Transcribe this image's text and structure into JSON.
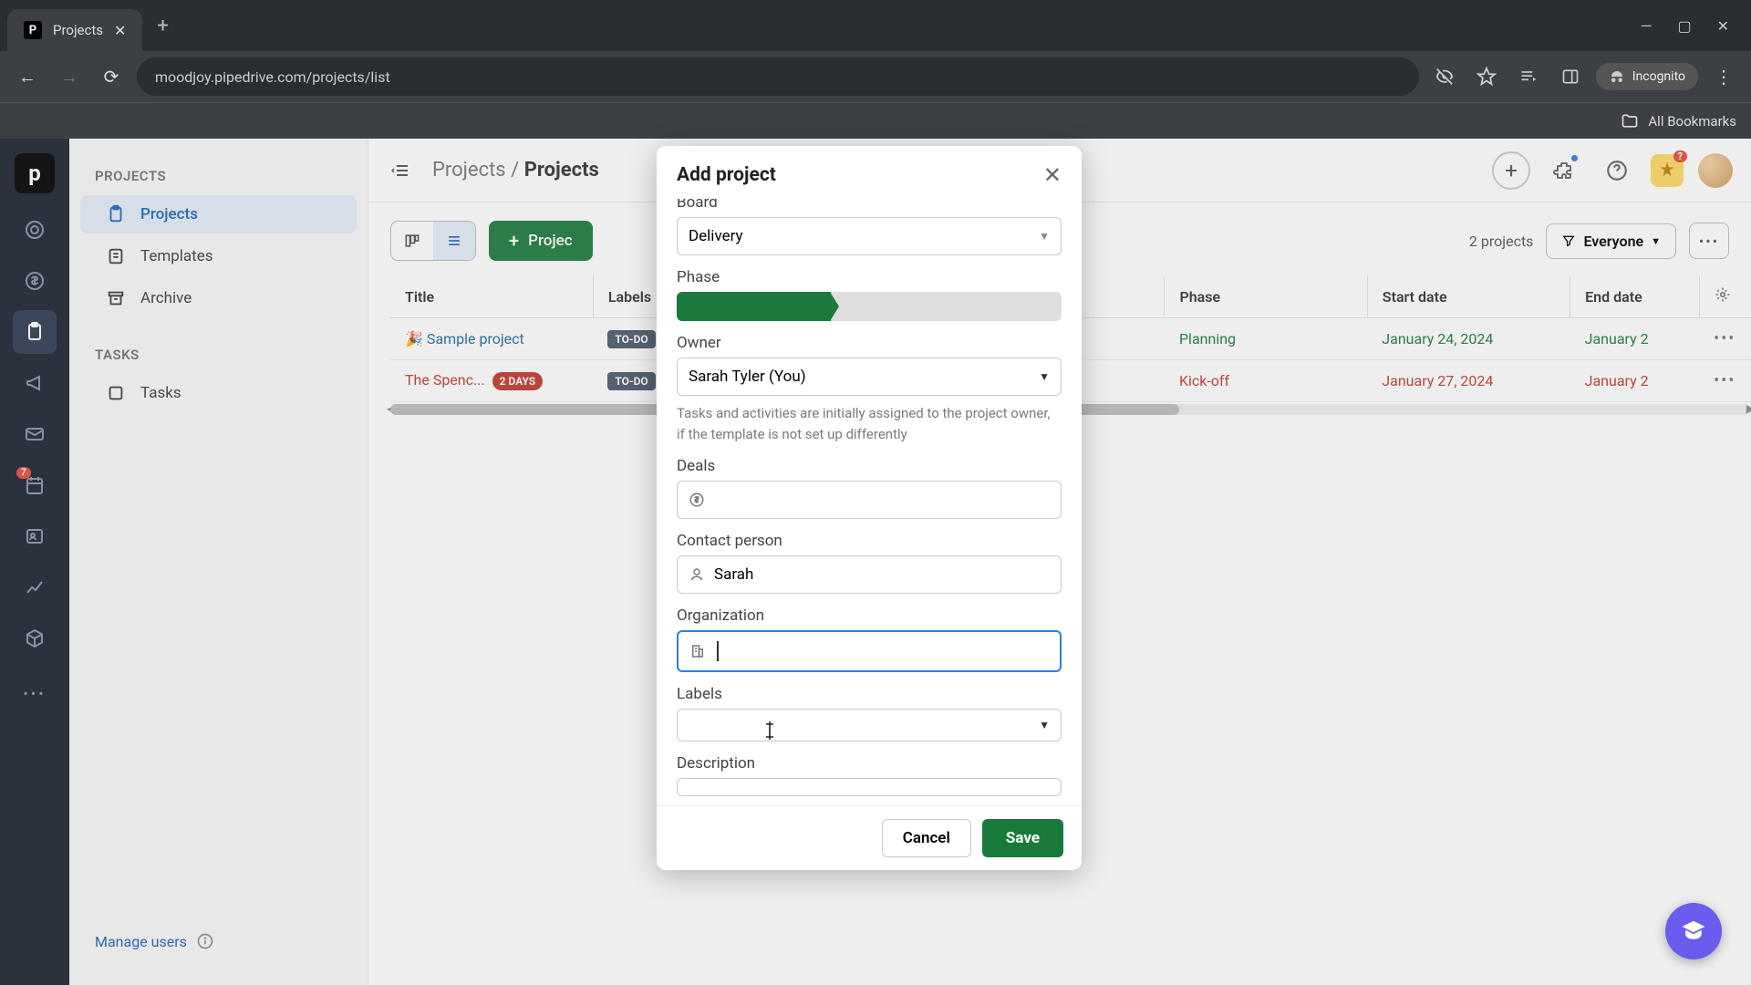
{
  "browser": {
    "tab_title": "Projects",
    "url": "moodjoy.pipedrive.com/projects/list",
    "incognito_label": "Incognito",
    "all_bookmarks": "All Bookmarks"
  },
  "rail": {
    "mail_badge": "7"
  },
  "sidebar": {
    "heading_projects": "PROJECTS",
    "items": [
      {
        "label": "Projects"
      },
      {
        "label": "Templates"
      },
      {
        "label": "Archive"
      }
    ],
    "heading_tasks": "TASKS",
    "task_items": [
      {
        "label": "Tasks"
      }
    ],
    "manage_users": "Manage users"
  },
  "header": {
    "bc_parent": "Projects",
    "bc_current": "Projects",
    "promo_badge": "?"
  },
  "toolbar": {
    "project_btn": "Projec",
    "count_label": "2 projects",
    "filter_label": "Everyone"
  },
  "table": {
    "headers": {
      "title": "Title",
      "labels": "Labels",
      "phase": "Phase",
      "start_date": "Start date",
      "end_date": "End date"
    },
    "rows": [
      {
        "emoji": "🎉",
        "title": "Sample project",
        "label": "TO-DO",
        "phase": "Planning",
        "phase_color": "green",
        "start_date": "January 24, 2024",
        "end_date": "January 2",
        "date_color": "green"
      },
      {
        "emoji": "",
        "title": "The Spenc...",
        "days": "2 DAYS",
        "label": "TO-DO",
        "phase": "Kick-off",
        "phase_color": "red",
        "start_date": "January 27, 2024",
        "end_date": "January 2",
        "date_color": "red",
        "title_color": "red"
      }
    ]
  },
  "modal": {
    "title": "Add project",
    "board_label": "Board",
    "board_value": "Delivery",
    "phase_label": "Phase",
    "owner_label": "Owner",
    "owner_value": "Sarah Tyler (You)",
    "owner_help": "Tasks and activities are initially assigned to the project owner, if the template is not set up differently",
    "deals_label": "Deals",
    "contact_label": "Contact person",
    "contact_value": "Sarah",
    "org_label": "Organization",
    "labels_label": "Labels",
    "desc_label": "Description",
    "cancel": "Cancel",
    "save": "Save"
  }
}
